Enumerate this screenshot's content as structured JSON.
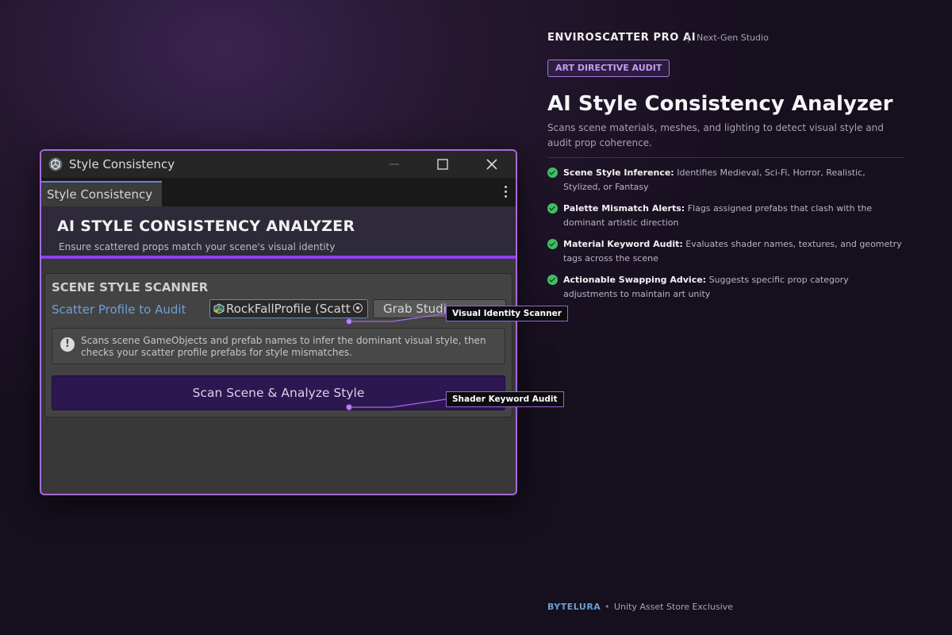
{
  "window": {
    "title": "Style Consistency",
    "tab_label": "Style Consistency",
    "banner_title": "AI STYLE CONSISTENCY ANALYZER",
    "banner_subtitle": "Ensure scattered props match your scene's visual identity",
    "scanner": {
      "section_title": "SCENE STYLE SCANNER",
      "profile_label": "Scatter Profile to Audit",
      "profile_value": "RockFallProfile (Scatt",
      "grab_button": "Grab Studio",
      "help_text": "Scans scene GameObjects and prefab names to infer the dominant visual style, then checks your scatter profile prefabs for style mismatches.",
      "scan_button": "Scan Scene & Analyze Style"
    }
  },
  "callouts": {
    "visual_identity": "Visual Identity Scanner",
    "shader_keyword": "Shader Keyword Audit"
  },
  "panel": {
    "brand": "ENVIROSCATTER PRO AI",
    "brand_separator": "|",
    "brand_sub": "Next-Gen Studio",
    "badge": "ART DIRECTIVE AUDIT",
    "title": "AI Style Consistency Analyzer",
    "description": "Scans scene materials, meshes, and lighting to detect visual style and audit prop coherence.",
    "features": [
      {
        "title": "Scene Style Inference:",
        "text": " Identifies Medieval, Sci-Fi, Horror, Realistic, Stylized, or Fantasy"
      },
      {
        "title": "Palette Mismatch Alerts:",
        "text": " Flags assigned prefabs that clash with the dominant artistic direction"
      },
      {
        "title": "Material Keyword Audit:",
        "text": " Evaluates shader names, textures, and geometry tags across the scene"
      },
      {
        "title": "Actionable Swapping Advice:",
        "text": " Suggests specific prop category adjustments to maintain art unity"
      }
    ]
  },
  "footer": {
    "brand": "BYTELURA",
    "separator": "•",
    "text": "Unity Asset Store Exclusive"
  },
  "colors": {
    "accent_purple": "#8d3ff0",
    "window_border": "#a86ad8",
    "check_green": "#3fbf63",
    "link_blue": "#6f9ed8"
  }
}
